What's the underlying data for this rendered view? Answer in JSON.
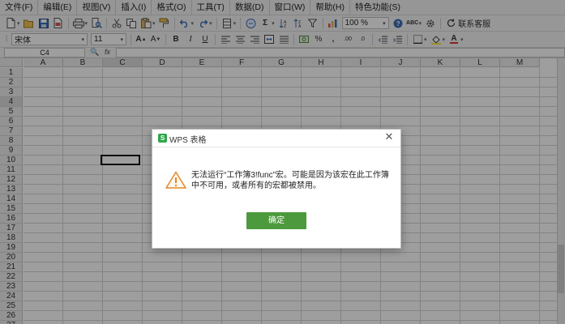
{
  "menu": [
    "文件(F)",
    "编辑(E)",
    "视图(V)",
    "插入(I)",
    "格式(O)",
    "工具(T)",
    "数据(D)",
    "窗口(W)",
    "帮助(H)",
    "特色功能(S)"
  ],
  "toolbar": {
    "zoom": "100 %",
    "service_label": "联系客服",
    "font_name": "宋体",
    "font_size": "11",
    "bold": "B",
    "italic": "I",
    "underline": "U",
    "sum_glyph": "Σ",
    "percent_glyph": "%",
    "comma_glyph": ",",
    "abc_glyph": "ABC",
    "font_color_glyph": "A"
  },
  "formula_bar": {
    "name_box": "C4",
    "fx": "fx",
    "value": ""
  },
  "sheet": {
    "columns": [
      "A",
      "B",
      "C",
      "D",
      "E",
      "F",
      "G",
      "H",
      "I",
      "J",
      "K",
      "L",
      "M"
    ],
    "rows": [
      "1",
      "2",
      "3",
      "4",
      "5",
      "6",
      "7",
      "8",
      "9",
      "10",
      "11",
      "12",
      "13",
      "14",
      "15",
      "16",
      "17",
      "18",
      "19",
      "20",
      "21",
      "22",
      "23",
      "24",
      "25",
      "26",
      "27"
    ],
    "active_cell": "C4"
  },
  "dialog": {
    "title": "WPS 表格",
    "logo_letter": "S",
    "message": "无法运行“工作簿3!func”宏。可能是因为该宏在此工作簿中不可用，或者所有的宏都被禁用。",
    "ok_label": "确定",
    "close_glyph": "✕",
    "accent_color": "#4c9a3d",
    "warning_color": "#e0882b"
  }
}
